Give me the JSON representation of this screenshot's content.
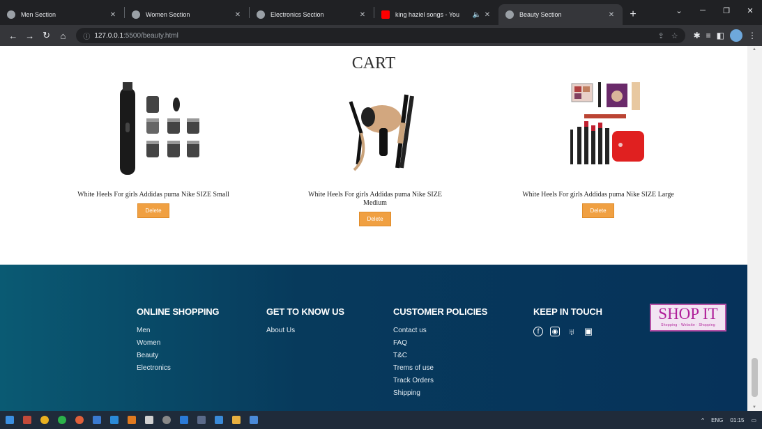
{
  "browser": {
    "tabs": [
      {
        "label": "Men Section",
        "favicon": "globe-icon",
        "active": false
      },
      {
        "label": "Women Section",
        "favicon": "globe-icon",
        "active": false
      },
      {
        "label": "Electronics Section",
        "favicon": "globe-icon",
        "active": false
      },
      {
        "label": "king haziel songs - You",
        "favicon": "youtube-icon",
        "active": false
      },
      {
        "label": "Beauty Section",
        "favicon": "globe-icon",
        "active": true
      }
    ],
    "new_tab": "+",
    "url_host": "127.0.0.1",
    "url_path": ":5500/beauty.html"
  },
  "page": {
    "title": "CART",
    "items": [
      {
        "desc": "White Heels For girls Addidas puma Nike SIZE Small",
        "button": "Delete",
        "image": "trimmer-kit-image"
      },
      {
        "desc": "White Heels For girls Addidas puma Nike SIZE Medium",
        "button": "Delete",
        "image": "hair-dryer-straightener-image"
      },
      {
        "desc": "White Heels For girls Addidas puma Nike SIZE Large",
        "button": "Delete",
        "image": "makeup-kit-image"
      }
    ]
  },
  "footer": {
    "online_shopping": {
      "title": "ONLINE SHOPPING",
      "links": [
        "Men",
        "Women",
        "Beauty",
        "Electronics"
      ]
    },
    "get_to_know": {
      "title": "GET TO KNOW US",
      "links": [
        "About Us"
      ]
    },
    "policies": {
      "title": "CUSTOMER POLICIES",
      "links": [
        "Contact us",
        "FAQ",
        "T&C",
        "Trems of use",
        "Track Orders",
        "Shipping"
      ]
    },
    "keep_in_touch": {
      "title": "KEEP IN TOUCH",
      "icons": [
        "facebook-icon",
        "instagram-icon",
        "twitter-icon",
        "youtube-icon"
      ]
    },
    "logo": {
      "text": "SHOP IT",
      "tagline": "Shopping · Website · Shopping"
    }
  },
  "taskbar": {
    "tray_lang": "ENG",
    "time": "01:15"
  },
  "colors": {
    "accent": "#f0a042",
    "footer": "#073a5c",
    "logo": "#b0209a"
  }
}
